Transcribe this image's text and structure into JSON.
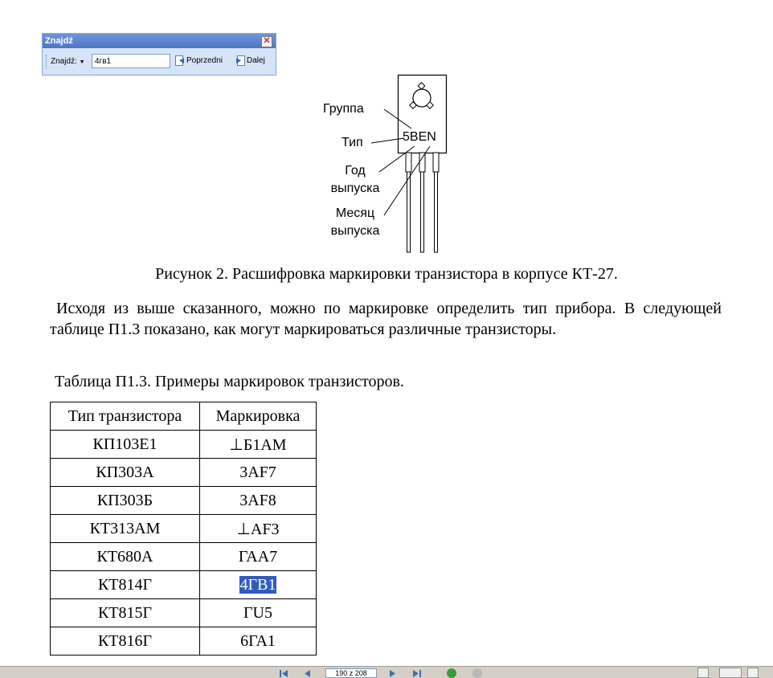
{
  "find_toolbar": {
    "title": "Znajdź",
    "label": "Znajdź:",
    "query": "4гв1",
    "prev_label": "Poprzedni",
    "next_label": "Dalej",
    "close_glyph": "✕"
  },
  "figure": {
    "labels": {
      "group": "Группа",
      "type": "Тип",
      "year_line1": "Год",
      "year_line2": "выпуска",
      "month_line1": "Месяц",
      "month_line2": "выпуска"
    },
    "marking": "5BEN"
  },
  "document": {
    "caption": "Рисунок 2. Расшифровка маркировки транзистора в корпусе КТ-27.",
    "paragraph": "Исходя из выше сказанного, можно по маркировке определить тип прибора. В следующей таблице П1.3 показано, как могут маркироваться различные транзисторы.",
    "table_title": "Таблица П1.3. Примеры маркировок транзисторов."
  },
  "table": {
    "headers": [
      "Тип транзистора",
      "Маркировка"
    ],
    "rows": [
      [
        "КП103Е1",
        "⊥Б1АМ"
      ],
      [
        "КП303А",
        "3AF7"
      ],
      [
        "КП303Б",
        "3AF8"
      ],
      [
        "КТ313АМ",
        "⊥AF3"
      ],
      [
        "КТ680А",
        "ГАА7"
      ],
      [
        "КТ814Г",
        "4ГВ1"
      ],
      [
        "КТ815Г",
        "ГU5"
      ],
      [
        "КТ816Г",
        "6ГА1"
      ]
    ]
  },
  "statusbar": {
    "page_indicator": "190 z 208"
  },
  "colors": {
    "highlight": "#2e5dbd",
    "toolbar_title": "#4d76c4",
    "toolbar_bg": "#d6e4f8"
  }
}
